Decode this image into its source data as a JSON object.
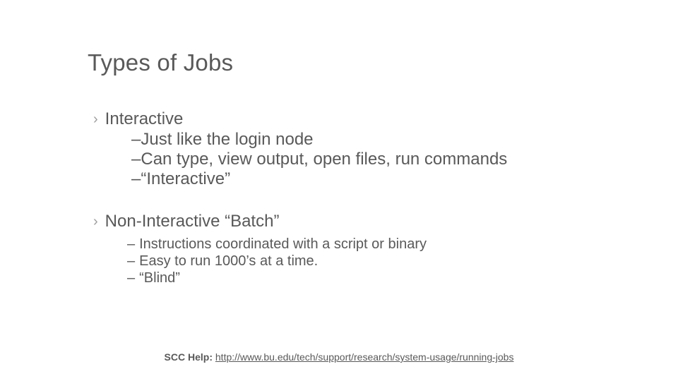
{
  "title": "Types of Jobs",
  "section1": {
    "heading": "Interactive",
    "items": [
      "Just like the login node",
      "Can type, view output, open files, run commands",
      "“Interactive”"
    ]
  },
  "section2": {
    "heading": "Non-Interactive “Batch”",
    "items": [
      "Instructions coordinated with a script or binary",
      "Easy to run 1000’s at a time.",
      "“Blind”"
    ]
  },
  "footer": {
    "label": "SCC Help: ",
    "url_text": "http://www.bu.edu/tech/support/research/system-usage/running-jobs",
    "url": "http://www.bu.edu/tech/support/research/system-usage/running-jobs"
  }
}
